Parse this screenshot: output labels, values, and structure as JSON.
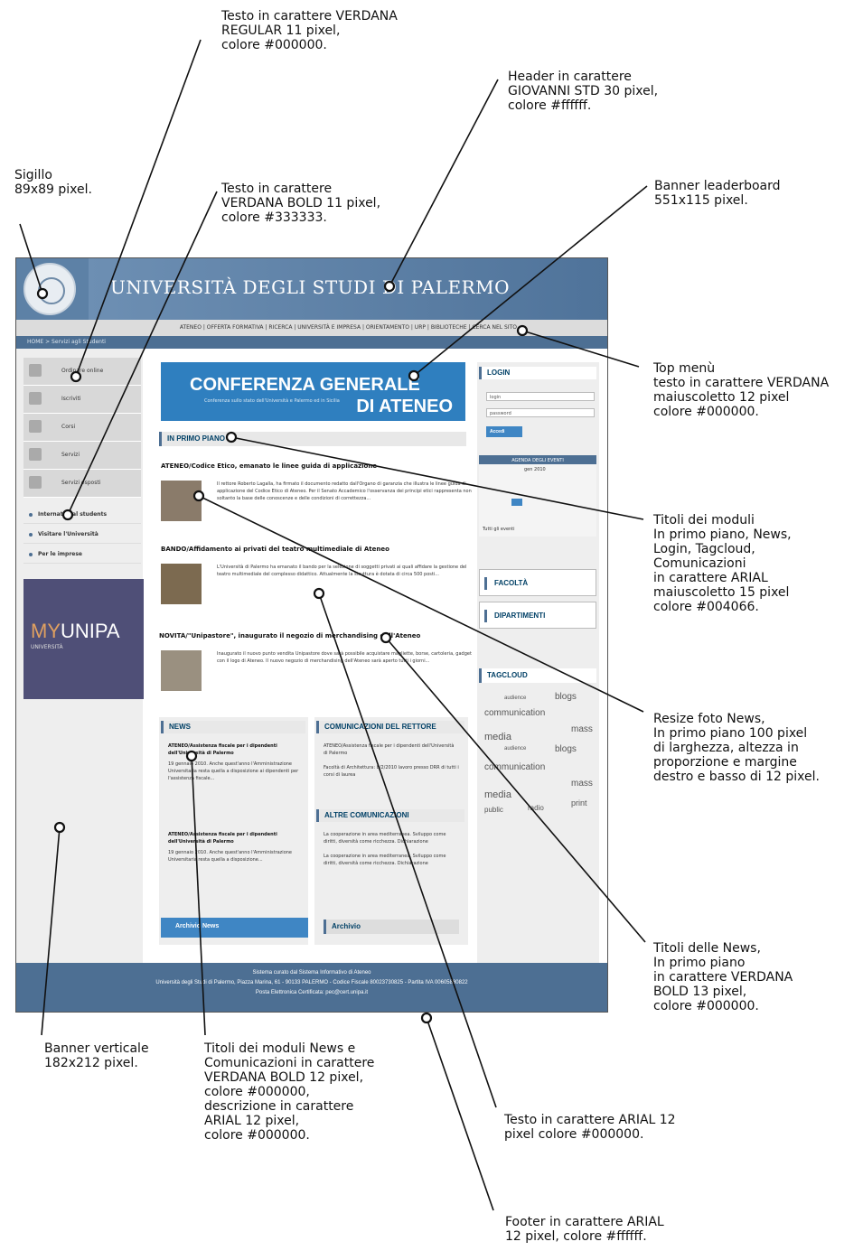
{
  "annotations": [
    {
      "id": "verdana-regular",
      "text": "Testo in carattere VERDANA\nREGULAR 11 pixel,\ncolore #000000."
    },
    {
      "id": "header",
      "text": "Header in carattere\nGIOVANNI STD 30 pixel,\ncolore #ffffff."
    },
    {
      "id": "sigillo",
      "text": "Sigillo\n89x89 pixel."
    },
    {
      "id": "verdana-bold",
      "text": "Testo in carattere\nVERDANA BOLD 11 pixel,\ncolore #333333."
    },
    {
      "id": "leaderboard",
      "text": "Banner leaderboard\n551x115 pixel."
    },
    {
      "id": "top-menu",
      "text": "Top menù\ntesto in carattere VERDANA\nmaiuscoletto 12 pixel\ncolore #000000."
    },
    {
      "id": "module-titles",
      "text": "Titoli dei moduli\nIn primo piano, News,\nLogin, Tagcloud,\nComunicazioni\nin carattere ARIAL\nmaiuscoletto 15 pixel\ncolore #004066."
    },
    {
      "id": "resize-photo",
      "text": "Resize foto News,\nIn primo piano 100 pixel\ndi larghezza, altezza in\nproporzione e margine\ndestro e basso di 12 pixel."
    },
    {
      "id": "news-titles",
      "text": "Titoli delle News,\nIn primo piano\nin carattere VERDANA\nBOLD 13 pixel,\ncolore #000000."
    },
    {
      "id": "vertical-banner",
      "text": "Banner verticale\n182x212 pixel."
    },
    {
      "id": "news-module-titles",
      "text": "Titoli dei moduli News e\nComunicazioni in carattere\nVERDANA BOLD 12 pixel,\ncolore #000000,\ndescrizione in carattere\nARIAL 12 pixel,\ncolore #000000."
    },
    {
      "id": "arial-text",
      "text": "Testo in carattere ARIAL 12\npixel colore #000000."
    },
    {
      "id": "footer",
      "text": "Footer in carattere ARIAL\n12 pixel, colore #ffffff."
    }
  ],
  "mockup": {
    "header_title": "UNIVERSITÀ DEGLI STUDI DI PALERMO",
    "top_menu": "ATENEO | OFFERTA FORMATIVA | RICERCA | UNIVERSITÀ E IMPRESA | ORIENTAMENTO | URP | BIBLIOTECHE | CERCA NEL SITO",
    "breadcrumb": "HOME > Servizi agli Studenti",
    "left_nav": [
      "Ordinare online",
      "Iscriviti",
      "Corsi",
      "Servizi",
      "Servizi esposti"
    ],
    "left_links": [
      "International students",
      "Visitare l'Università",
      "Per le imprese"
    ],
    "banner": {
      "my": "MY",
      "unipa": "UNIPA",
      "sub": "UNIVERSITÀ"
    },
    "leaderboard": {
      "line1": "CONFERENZA GENERALE",
      "line2": "DI ATENEO",
      "small": "Conferenza sullo stato dell'Università\ne Palermo ed in Sicilia"
    },
    "module_primo_piano": "IN PRIMO PIANO",
    "news_items": [
      {
        "title": "ATENEO/Codice Etico, emanato le linee guida di applicazione",
        "text": "Il rettore Roberto Lagalla, ha firmato il documento redatto dall'Organo di garanzia che illustra le linee guida di applicazione del Codice Etico di Ateneo. Per il Senato Accademico l'osservanza dei principi etici rappresenta non soltanto la base delle conoscenze e delle condizioni di correttezza..."
      },
      {
        "title": "BANDO/Affidamento ai privati del teatro multimediale di Ateneo",
        "text": "L'Università di Palermo ha emanato il bando per la selezione di soggetti privati ai quali affidare la gestione del teatro multimediale del complesso didattico. Attualmente la struttura è dotata di circa 500 posti..."
      },
      {
        "title": "NOVITÀ/\"Unipastore\", inaugurato il negozio di merchandising dell'Ateneo",
        "text": "Inaugurato il nuovo punto vendita Unipastore dove sarà possibile acquistare magliette, borse, cartoleria, gadget con il logo di Ateneo. Il nuovo negozio di merchandising dell'Ateneo sarà aperto tutti i giorni..."
      }
    ],
    "module_news": "NEWS",
    "news_list": [
      {
        "title": "ATENEO/Assistenza fiscale per i dipendenti dell'Università di Palermo",
        "text": "19 gennaio 2010. Anche quest'anno l'Amministrazione Universitaria resta quella a disposizione ai dipendenti per l'assistenza fiscale..."
      },
      {
        "title": "ATENEO/Assistenza fiscale per i dipendenti dell'Università di Palermo",
        "text": "19 gennaio 2010. Anche quest'anno l'Amministrazione Universitaria resta quella a disposizione..."
      }
    ],
    "archivio_news": "Archivio News",
    "module_comunicazioni": "COMUNICAZIONI DEL RETTORE",
    "comunicazioni_text": "ATENEO/Assistenza fiscale per i dipendenti dell'Università di Palermo\n\nFacoltà di Architettura: 8/2/2010 lavoro presso DRR di tutti i corsi di laurea",
    "module_altre": "ALTRE COMUNICAZIONI",
    "altre_text": "La cooperazione in area mediterranea. Sviluppo come diritti, diversità come ricchezza. Dichiarazione\n\nLa cooperazione in area mediterranea. Sviluppo come diritti, diversità come ricchezza. Dichiarazione",
    "archivio": "Archivio",
    "login": {
      "title": "LOGIN",
      "user_placeholder": "login",
      "pass_placeholder": "password",
      "button": "Accedi"
    },
    "agenda": {
      "title": "AGENDA DEGLI EVENTI",
      "month": "gen 2010",
      "all_events": "Tutti gli eventi"
    },
    "facolta": "FACOLTÀ",
    "dipartimenti": "DIPARTIMENTI",
    "tagcloud_title": "TAGCLOUD",
    "tags": [
      "audience",
      "blogs",
      "communication",
      "media",
      "mass",
      "print",
      "public",
      "radio"
    ],
    "footer_lines": [
      "Sistema curato dal Sistema Informativo di Ateneo",
      "Università degli Studi di Palermo, Piazza Marina, 61 - 90133 PALERMO - Codice Fiscale 80023730825 - Partita IVA 00605880822",
      "Posta Elettronica Certificata: pec@cert.unipa.it"
    ]
  }
}
